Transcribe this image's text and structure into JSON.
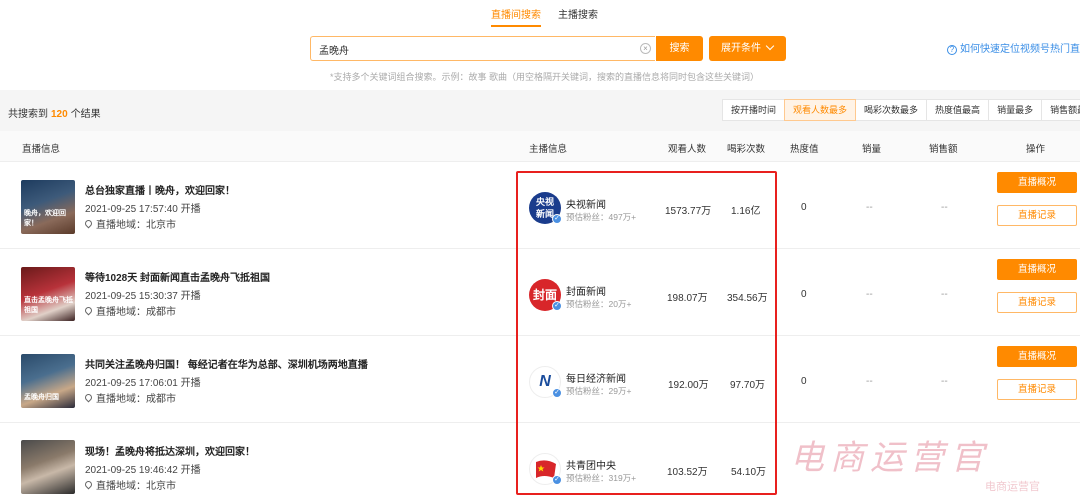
{
  "tabs": [
    {
      "label": "直播间搜索",
      "active": true
    },
    {
      "label": "主播搜索",
      "active": false
    }
  ],
  "search": {
    "value": "孟晚舟",
    "placeholder": "",
    "button": "搜索",
    "expand": "展开条件",
    "hint": "*支持多个关键词组合搜索。示例：故事 歌曲（用空格隔开关键词，搜索的直播信息将同时包含这些关键词）",
    "help": "如何快速定位视频号热门直播"
  },
  "results": {
    "prefix": "共搜索到",
    "count": "120",
    "suffix": "个结果"
  },
  "sort": [
    {
      "label": "按开播时间",
      "active": false
    },
    {
      "label": "观看人数最多",
      "active": true
    },
    {
      "label": "喝彩次数最多",
      "active": false
    },
    {
      "label": "热度值最高",
      "active": false
    },
    {
      "label": "销量最多",
      "active": false
    },
    {
      "label": "销售额最多",
      "active": false
    }
  ],
  "columns": {
    "live": "直播信息",
    "anchor": "主播信息",
    "viewers": "观看人数",
    "cheers": "喝彩次数",
    "heat": "热度值",
    "sales": "销量",
    "revenue": "销售额",
    "ops": "操作"
  },
  "rows": [
    {
      "title": "总台独家直播丨晚舟，欢迎回家！",
      "time": "2021-09-25 17:57:40 开播",
      "location": "直播地域：北京市",
      "thumb_text": "晚舟，欢迎回家！",
      "anchor": "央视新闻",
      "avatar_text": "央视\n新闻",
      "fans": "预估粉丝：497万+",
      "viewers": "1573.77万",
      "cheers": "1.16亿",
      "heat": "0",
      "sales": "--",
      "revenue": "--"
    },
    {
      "title": "等待1028天 封面新闻直击孟晚舟飞抵祖国",
      "time": "2021-09-25 15:30:37 开播",
      "location": "直播地域：成都市",
      "thumb_text": "直击孟晚舟飞抵祖国",
      "anchor": "封面新闻",
      "avatar_text": "封面",
      "fans": "预估粉丝：20万+",
      "viewers": "198.07万",
      "cheers": "354.56万",
      "heat": "0",
      "sales": "--",
      "revenue": "--"
    },
    {
      "title": "共同关注孟晚舟归国！ 每经记者在华为总部、深圳机场两地直播",
      "time": "2021-09-25 17:06:01 开播",
      "location": "直播地域：成都市",
      "thumb_text": "孟晚舟归国",
      "anchor": "每日经济新闻",
      "avatar_text": "N",
      "fans": "预估粉丝：29万+",
      "viewers": "192.00万",
      "cheers": "97.70万",
      "heat": "0",
      "sales": "--",
      "revenue": "--"
    },
    {
      "title": "现场！孟晚舟将抵达深圳，欢迎回家！",
      "time": "2021-09-25 19:46:42 开播",
      "location": "直播地域：北京市",
      "thumb_text": "",
      "anchor": "共青团中央",
      "avatar_text": "",
      "fans": "预估粉丝：319万+",
      "viewers": "103.52万",
      "cheers": "54.10万",
      "heat": "",
      "sales": "",
      "revenue": ""
    }
  ],
  "actions": {
    "overview": "直播概况",
    "record": "直播记录"
  },
  "watermark": {
    "main": "电商运营官",
    "sub": "电商运营官"
  },
  "colors": {
    "accent": "#ff8a00",
    "highlight": "#e8201e",
    "link": "#3a8ee6"
  }
}
